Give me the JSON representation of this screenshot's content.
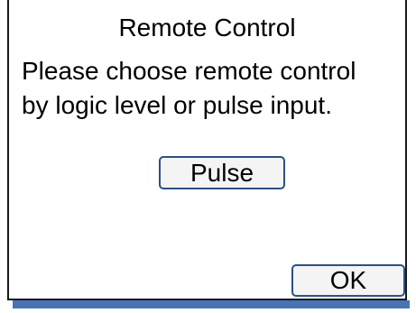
{
  "dialog": {
    "title": "Remote Control",
    "message_lines": [
      "Please choose remote control",
      "by logic level or pulse input."
    ],
    "mode_button_label": "Pulse",
    "ok_button_label": "OK"
  },
  "colors": {
    "shadow": "#4a73b5",
    "button_border": "#2c4f86",
    "button_bg": "#f4f4f4"
  }
}
